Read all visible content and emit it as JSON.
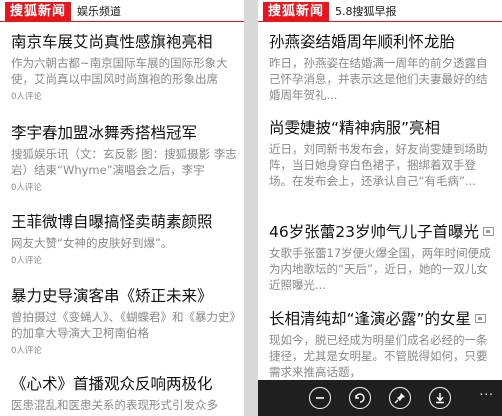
{
  "left": {
    "brand": "搜狐新闻",
    "channel": "娱乐频道",
    "articles": [
      {
        "title": "南京车展艾尚真性感旗袍亮相",
        "summary": "作为六朝古都~南京国际车展的国际形象大使，艾尚真以中国风时尚旗袍的形象出席",
        "comments": "0人评论",
        "has_image": false
      },
      {
        "title": "李宇春加盟冰舞秀搭档冠军",
        "summary": "搜狐娱乐讯（文：玄反影 图：搜狐摄影 李志岩）结束“Whyme”演唱会之后，李宇",
        "comments": "0人评论",
        "has_image": false
      },
      {
        "title": "王菲微博自曝搞怪卖萌素颜照",
        "summary": "网友大赞“女神的皮肤好到爆”。",
        "comments": "0人评论",
        "has_image": false
      },
      {
        "title": "暴力史导演客串《矫正未来》",
        "summary": "曾拍摄过《变蝇人》、《蝴蝶君》和《暴力史》的加拿大导演大卫柯南伯格",
        "comments": "0人评论",
        "has_image": false
      },
      {
        "title": "《心术》首播观众反响两极化",
        "summary": "医患混乱和医患关系的表现形式引发众多",
        "comments": "",
        "has_image": false
      }
    ]
  },
  "right": {
    "brand": "搜狐新闻",
    "channel": "5.8搜狐早报",
    "articles": [
      {
        "title": "孙燕姿结婚周年顺利怀龙胎",
        "summary": "昨日，孙燕姿在结婚满一周年的前夕透露自己怀孕消息，并表示这是他们夫妻最好的结婚周年贺礼...",
        "comments": "",
        "has_image": false
      },
      {
        "title": "尚雯婕披“精神病服”亮相",
        "summary": "近日，刘同新书发布会，好友尚雯婕到场助阵，当日她身穿白色裙子，捆绑着双手登场。在发布会上，还承认自己“有毛病”...",
        "comments": "",
        "has_image": false
      },
      {
        "title": "46岁张蕾23岁帅气儿子首曝光",
        "summary": "女歌手张蕾17岁便火爆全国，两年时间便成为内地歌坛的“天后”，近日，她的一双儿女近照曝光...",
        "comments": "",
        "has_image": true
      },
      {
        "title": "长相清纯却“逢演必露”的女星",
        "summary": "现如今，脱已经成为明星们成名必经的一条捷径，尤其是女明星。不管脱得如何，只要需求来推高话题，",
        "comments": "",
        "has_image": true
      }
    ]
  },
  "appbar": {
    "buttons": [
      "minus-icon",
      "tag-refresh-icon",
      "pin-icon",
      "download-icon"
    ],
    "more": "..."
  }
}
